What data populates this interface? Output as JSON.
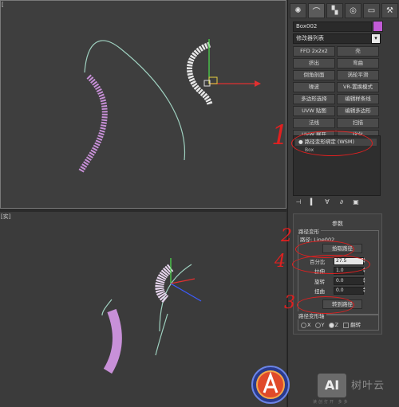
{
  "viewport_top": {
    "label": "["
  },
  "viewport_bottom": {
    "label": "[实]"
  },
  "panel": {
    "tabs": [
      {
        "icon": "sun-icon",
        "glyph": "✺"
      },
      {
        "icon": "curve-icon",
        "glyph": "⌒"
      },
      {
        "icon": "hierarchy-icon",
        "glyph": "▚"
      },
      {
        "icon": "motion-icon",
        "glyph": "◎"
      },
      {
        "icon": "display-icon",
        "glyph": "▭"
      },
      {
        "icon": "hammer-icon",
        "glyph": "⚒"
      }
    ],
    "object_name": "Box002",
    "object_color": "#c25bd6",
    "modifier_list": "修改器列表",
    "modifier_buttons": [
      "FFD 2x2x2",
      "壳",
      "挤出",
      "弯曲",
      "倒角剖面",
      "涡轮平滑",
      "噪波",
      "VR-置换模式",
      "多边形选择",
      "编辑样条线",
      "UVW 贴图",
      "编辑多边形",
      "法线",
      "扫描",
      "UVW 展开",
      "优化"
    ],
    "stack": {
      "item": "路径变形绑定 (WSM)",
      "sub": "Box"
    },
    "stack_tools": [
      "⊣",
      "▍",
      "∀",
      "∂",
      "▣"
    ]
  },
  "params": {
    "title": "参数",
    "group_title": "路径变形",
    "path_label": "路径: Line002",
    "pick_path": "拾取路径",
    "percent_label": "百分比",
    "percent_value": "27.5",
    "stretch_label": "拉伸",
    "stretch_value": "1.0",
    "rotation_label": "旋转",
    "rotation_value": "0.0",
    "twist_label": "扭曲",
    "twist_value": "0.0",
    "move_to_path": "转到路径",
    "axis_group": "路径变形轴",
    "axis_options": [
      "X",
      "Y",
      "Z"
    ],
    "axis_selected": "Z",
    "flip_label": "翻转"
  },
  "annotations": [
    "1",
    "2",
    "4",
    "3"
  ],
  "watermark": {
    "box": "AI",
    "text": "树叶云",
    "sub": "读创打开 多多"
  },
  "colors": {
    "annotation_red": "#e02020",
    "object_pink": "#c890d8",
    "curve_green": "#9fd1c0",
    "axis_red": "#e03030",
    "axis_green": "#4ce04c",
    "axis_blue": "#3c5cff"
  }
}
